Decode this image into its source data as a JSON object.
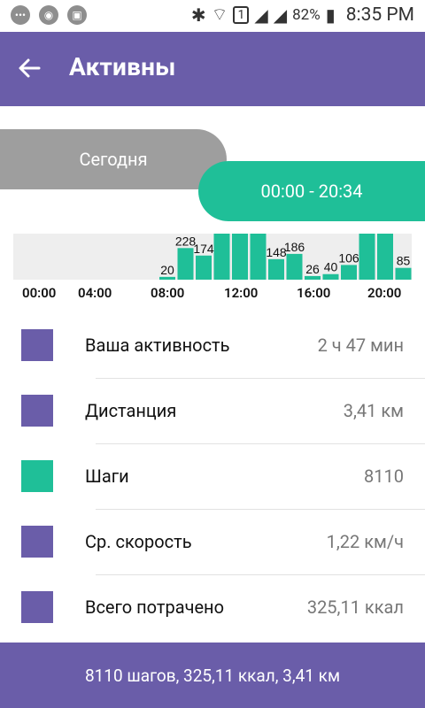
{
  "status": {
    "battery": "82%",
    "time": "8:35 PM",
    "sim_badge": "1"
  },
  "appbar": {
    "title": "Активны"
  },
  "toggle": {
    "left_label": "Сегодня",
    "right_label": "00:00 - 20:34"
  },
  "chart_data": {
    "type": "bar",
    "x_ticks": [
      "00:00",
      "04:00",
      "08:00",
      "12:00",
      "16:00",
      "20:00"
    ],
    "bars": [
      {
        "slot": "08:00",
        "value": 20,
        "label": "20"
      },
      {
        "slot": "09:00",
        "value": 228,
        "label": "228"
      },
      {
        "slot": "10:00",
        "value": 174,
        "label": "174"
      },
      {
        "slot": "11:00",
        "value": null,
        "label": ""
      },
      {
        "slot": "12:00",
        "value": null,
        "label": ""
      },
      {
        "slot": "13:00",
        "value": null,
        "label": ""
      },
      {
        "slot": "14:00",
        "value": 148,
        "label": "148"
      },
      {
        "slot": "15:00",
        "value": 186,
        "label": "186"
      },
      {
        "slot": "16:00",
        "value": 26,
        "label": "26"
      },
      {
        "slot": "17:00",
        "value": 40,
        "label": "40"
      },
      {
        "slot": "18:00",
        "value": 106,
        "label": "106"
      },
      {
        "slot": "19:00",
        "value": null,
        "label": ""
      },
      {
        "slot": "20:00",
        "value": null,
        "label": ""
      },
      {
        "slot": "21:00",
        "value": 85,
        "label": "85"
      }
    ],
    "bar_color": "#1fbf98"
  },
  "metrics": [
    {
      "label": "Ваша активность",
      "value": "2 ч 47 мин",
      "color": "#6a5da9"
    },
    {
      "label": "Дистанция",
      "value": "3,41 км",
      "color": "#6a5da9"
    },
    {
      "label": "Шаги",
      "value": "8110",
      "color": "#1fbf98"
    },
    {
      "label": "Ср. скорость",
      "value": "1,22 км/ч",
      "color": "#6a5da9"
    },
    {
      "label": "Всего потрачено",
      "value": "325,11 ккал",
      "color": "#6a5da9"
    }
  ],
  "summary": {
    "text": "8110 шагов, 325,11 ккал, 3,41 км"
  },
  "colors": {
    "primary": "#6a5da9",
    "accent": "#1fbf98",
    "inactive_pill": "#9e9e9e"
  }
}
